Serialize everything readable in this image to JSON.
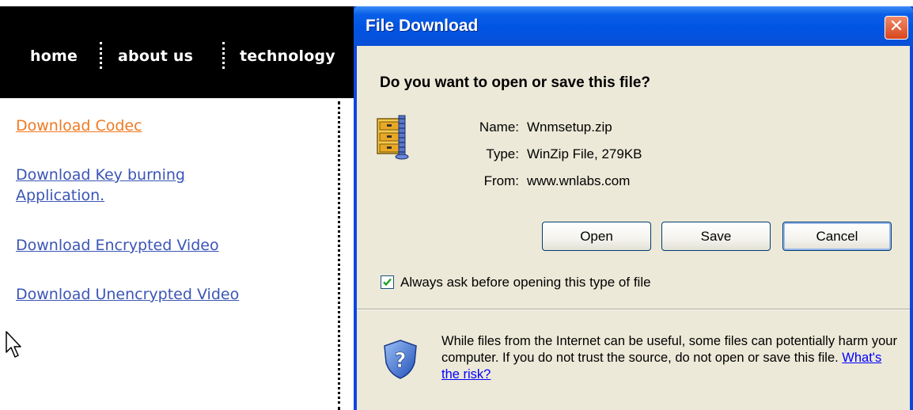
{
  "nav": {
    "items": [
      {
        "label": "home"
      },
      {
        "label": "about us"
      },
      {
        "label": "technology"
      }
    ]
  },
  "downloads": {
    "links": [
      {
        "label": "Download Codec",
        "visited": true
      },
      {
        "label": "Download Key burning Application.",
        "visited": false
      },
      {
        "label": "Download Encrypted Video",
        "visited": false
      },
      {
        "label": "Download Unencrypted Video",
        "visited": false
      }
    ]
  },
  "dialog": {
    "title": "File Download",
    "close_glyph": "✕",
    "question": "Do you want to open or save this file?",
    "file_icon": "winzip-file-icon",
    "name_label": "Name:",
    "name_value": "Wnmsetup.zip",
    "type_label": "Type:",
    "type_value": "WinZip File, 279KB",
    "from_label": "From:",
    "from_value": "www.wnlabs.com",
    "buttons": {
      "open": "Open",
      "save": "Save",
      "cancel": "Cancel"
    },
    "always_ask": {
      "label": "Always ask before opening this type of file",
      "checked": true
    },
    "warning": {
      "icon": "security-shield-question-icon",
      "text": "While files from the Internet can be useful, some files can potentially harm your computer. If you do not trust the source, do not open or save this file.",
      "link": "What's the risk?"
    }
  },
  "colors": {
    "xp_title_blue": "#0054e3",
    "dialog_face": "#ece9d8",
    "link_blue": "#3b55b5",
    "link_visited": "#f07a22",
    "close_red": "#d8461c"
  }
}
